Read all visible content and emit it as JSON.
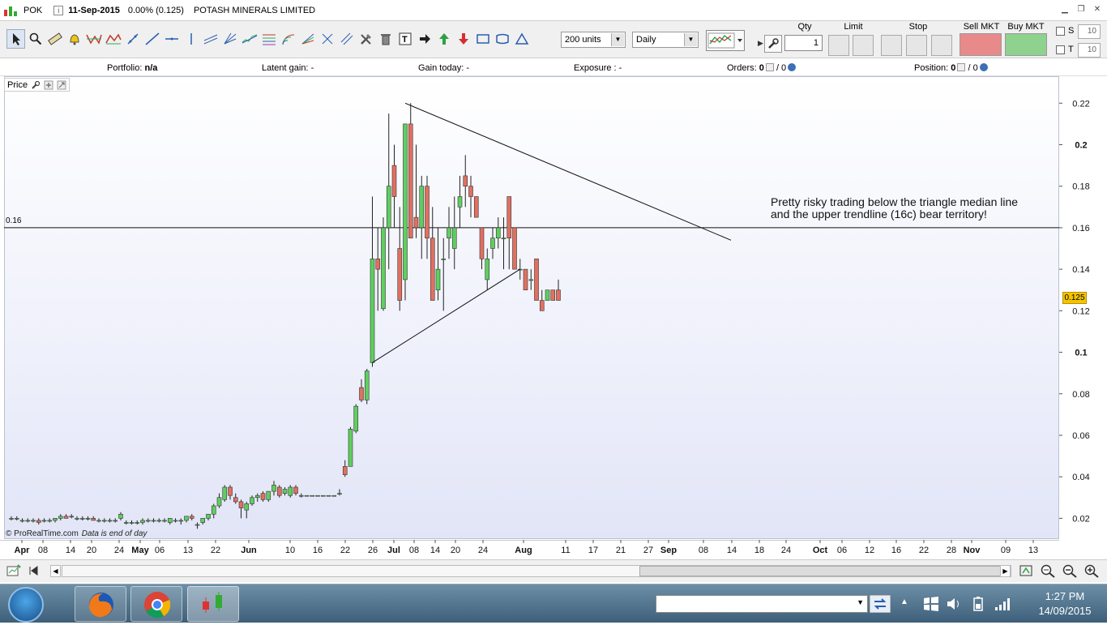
{
  "window": {
    "symbol": "POK",
    "date": "11-Sep-2015",
    "change": "0.00% (0.125)",
    "name": "POTASH MINERALS LIMITED"
  },
  "toolbar": {
    "units_value": "200 units",
    "period_value": "Daily"
  },
  "trade_panel": {
    "qty_label": "Qty",
    "qty_value": "1",
    "limit_label": "Limit",
    "stop_label": "Stop",
    "sell_label": "Sell MKT",
    "buy_label": "Buy MKT",
    "s_label": "S",
    "s_value": "10",
    "t_label": "T",
    "t_value": "10",
    "sell_color": "#e88a8a",
    "buy_color": "#8fd18f"
  },
  "portfolio_bar": {
    "portfolio_label": "Portfolio:",
    "portfolio_value": "n/a",
    "latent_label": "Latent gain:",
    "latent_value": "-",
    "today_label": "Gain today:",
    "today_value": "-",
    "exposure_label": "Exposure :",
    "exposure_value": "-",
    "orders_label": "Orders:",
    "orders_a": "0",
    "orders_b": "/ 0",
    "position_label": "Position:",
    "position_a": "0",
    "position_b": "/ 0"
  },
  "chart": {
    "panel_label": "Price",
    "copyright": "© ProRealTime.com",
    "data_note": "Data is end of day",
    "annotation_line1": "Pretty risky trading below the triangle median line",
    "annotation_line2": "and the upper trendline (16c) bear territory!",
    "hline_label": "0.16",
    "current_price": "0.125",
    "up_color": "#5fcf5f",
    "down_color": "#e07060"
  },
  "chart_data": {
    "type": "candlestick",
    "ylim": [
      0.01,
      0.233
    ],
    "y_ticks": [
      "0.22",
      "0.2",
      "0.18",
      "0.16",
      "0.14",
      "0.12",
      "0.1",
      "0.08",
      "0.06",
      "0.04",
      "0.02"
    ],
    "x_ticks": [
      "Apr",
      "08",
      "14",
      "20",
      "24",
      "May",
      "06",
      "13",
      "22",
      "Jun",
      "10",
      "16",
      "22",
      "26",
      "Jul",
      "08",
      "14",
      "20",
      "24",
      "Aug",
      "11",
      "17",
      "21",
      "27",
      "Sep",
      "08",
      "14",
      "18",
      "24",
      "Oct",
      "06",
      "12",
      "16",
      "22",
      "28",
      "Nov",
      "09",
      "13"
    ],
    "horizontal_line": 0.16,
    "candles": [
      [
        0.02,
        0.021,
        0.019,
        0.02
      ],
      [
        0.02,
        0.021,
        0.019,
        0.02
      ],
      [
        0.019,
        0.02,
        0.018,
        0.019
      ],
      [
        0.019,
        0.02,
        0.018,
        0.019
      ],
      [
        0.019,
        0.02,
        0.018,
        0.019
      ],
      [
        0.019,
        0.02,
        0.017,
        0.018
      ],
      [
        0.019,
        0.02,
        0.018,
        0.019
      ],
      [
        0.019,
        0.02,
        0.018,
        0.019
      ],
      [
        0.019,
        0.02,
        0.018,
        0.02
      ],
      [
        0.02,
        0.022,
        0.019,
        0.021
      ],
      [
        0.021,
        0.022,
        0.02,
        0.02
      ],
      [
        0.021,
        0.022,
        0.02,
        0.021
      ],
      [
        0.02,
        0.021,
        0.019,
        0.02
      ],
      [
        0.02,
        0.021,
        0.019,
        0.02
      ],
      [
        0.02,
        0.021,
        0.019,
        0.02
      ],
      [
        0.02,
        0.021,
        0.019,
        0.019
      ],
      [
        0.019,
        0.02,
        0.018,
        0.019
      ],
      [
        0.019,
        0.02,
        0.018,
        0.019
      ],
      [
        0.019,
        0.02,
        0.018,
        0.019
      ],
      [
        0.019,
        0.02,
        0.018,
        0.019
      ],
      [
        0.02,
        0.023,
        0.019,
        0.022
      ],
      [
        0.018,
        0.019,
        0.017,
        0.018
      ],
      [
        0.018,
        0.019,
        0.017,
        0.018
      ],
      [
        0.018,
        0.019,
        0.017,
        0.018
      ],
      [
        0.018,
        0.02,
        0.017,
        0.019
      ],
      [
        0.019,
        0.02,
        0.018,
        0.019
      ],
      [
        0.019,
        0.02,
        0.018,
        0.019
      ],
      [
        0.019,
        0.02,
        0.018,
        0.019
      ],
      [
        0.019,
        0.02,
        0.018,
        0.019
      ],
      [
        0.018,
        0.02,
        0.017,
        0.02
      ],
      [
        0.019,
        0.02,
        0.018,
        0.019
      ],
      [
        0.019,
        0.02,
        0.017,
        0.019
      ],
      [
        0.019,
        0.021,
        0.018,
        0.021
      ],
      [
        0.021,
        0.022,
        0.019,
        0.02
      ],
      [
        0.017,
        0.018,
        0.015,
        0.017
      ],
      [
        0.018,
        0.02,
        0.017,
        0.02
      ],
      [
        0.02,
        0.022,
        0.019,
        0.022
      ],
      [
        0.022,
        0.027,
        0.02,
        0.026
      ],
      [
        0.026,
        0.032,
        0.025,
        0.03
      ],
      [
        0.029,
        0.036,
        0.028,
        0.035
      ],
      [
        0.035,
        0.036,
        0.029,
        0.031
      ],
      [
        0.03,
        0.032,
        0.027,
        0.028
      ],
      [
        0.028,
        0.029,
        0.02,
        0.025
      ],
      [
        0.024,
        0.028,
        0.02,
        0.027
      ],
      [
        0.027,
        0.031,
        0.026,
        0.03
      ],
      [
        0.03,
        0.032,
        0.028,
        0.031
      ],
      [
        0.032,
        0.033,
        0.028,
        0.029
      ],
      [
        0.029,
        0.033,
        0.028,
        0.033
      ],
      [
        0.033,
        0.038,
        0.031,
        0.036
      ],
      [
        0.035,
        0.036,
        0.03,
        0.031
      ],
      [
        0.032,
        0.035,
        0.031,
        0.034
      ],
      [
        0.031,
        0.036,
        0.03,
        0.035
      ],
      [
        0.035,
        0.036,
        0.031,
        0.032
      ],
      [
        0.031,
        0.032,
        0.03,
        0.031
      ],
      [
        0.031,
        0.031,
        0.031,
        0.031
      ],
      [
        0.031,
        0.031,
        0.031,
        0.031
      ],
      [
        0.031,
        0.031,
        0.031,
        0.031
      ],
      [
        0.031,
        0.031,
        0.031,
        0.031
      ],
      [
        0.031,
        0.031,
        0.031,
        0.031
      ],
      [
        0.031,
        0.031,
        0.031,
        0.031
      ],
      [
        0.032,
        0.034,
        0.031,
        0.032
      ],
      [
        0.045,
        0.048,
        0.04,
        0.041
      ],
      [
        0.045,
        0.064,
        0.045,
        0.063
      ],
      [
        0.062,
        0.075,
        0.061,
        0.074
      ],
      [
        0.083,
        0.087,
        0.076,
        0.077
      ],
      [
        0.077,
        0.092,
        0.075,
        0.091
      ],
      [
        0.095,
        0.175,
        0.093,
        0.145
      ],
      [
        0.145,
        0.16,
        0.12,
        0.14
      ],
      [
        0.121,
        0.165,
        0.12,
        0.16
      ],
      [
        0.16,
        0.215,
        0.14,
        0.18
      ],
      [
        0.19,
        0.2,
        0.16,
        0.175
      ],
      [
        0.15,
        0.17,
        0.12,
        0.125
      ],
      [
        0.135,
        0.2,
        0.125,
        0.21
      ],
      [
        0.21,
        0.22,
        0.155,
        0.155
      ],
      [
        0.165,
        0.2,
        0.155,
        0.16
      ],
      [
        0.16,
        0.185,
        0.145,
        0.18
      ],
      [
        0.18,
        0.185,
        0.145,
        0.155
      ],
      [
        0.155,
        0.17,
        0.125,
        0.125
      ],
      [
        0.13,
        0.16,
        0.125,
        0.14
      ],
      [
        0.145,
        0.155,
        0.12,
        0.145
      ],
      [
        0.155,
        0.17,
        0.145,
        0.16
      ],
      [
        0.15,
        0.175,
        0.14,
        0.16
      ],
      [
        0.17,
        0.185,
        0.16,
        0.175
      ],
      [
        0.185,
        0.195,
        0.17,
        0.18
      ],
      [
        0.18,
        0.185,
        0.165,
        0.175
      ],
      [
        0.175,
        0.175,
        0.165,
        0.165
      ],
      [
        0.16,
        0.16,
        0.14,
        0.145
      ],
      [
        0.135,
        0.15,
        0.13,
        0.145
      ],
      [
        0.15,
        0.16,
        0.145,
        0.155
      ],
      [
        0.155,
        0.165,
        0.15,
        0.16
      ],
      [
        0.155,
        0.165,
        0.14,
        0.155
      ],
      [
        0.175,
        0.175,
        0.14,
        0.155
      ],
      [
        0.16,
        0.16,
        0.14,
        0.14
      ],
      [
        0.14,
        0.145,
        0.135,
        0.14
      ],
      [
        0.14,
        0.14,
        0.13,
        0.13
      ],
      [
        0.135,
        0.14,
        0.13,
        0.135
      ],
      [
        0.145,
        0.145,
        0.125,
        0.125
      ],
      [
        0.125,
        0.13,
        0.12,
        0.12
      ],
      [
        0.125,
        0.13,
        0.125,
        0.13
      ],
      [
        0.13,
        0.13,
        0.125,
        0.125
      ],
      [
        0.13,
        0.135,
        0.125,
        0.125
      ]
    ]
  },
  "scrollbar": {},
  "taskbar": {
    "time": "1:27 PM",
    "date": "14/09/2015"
  }
}
